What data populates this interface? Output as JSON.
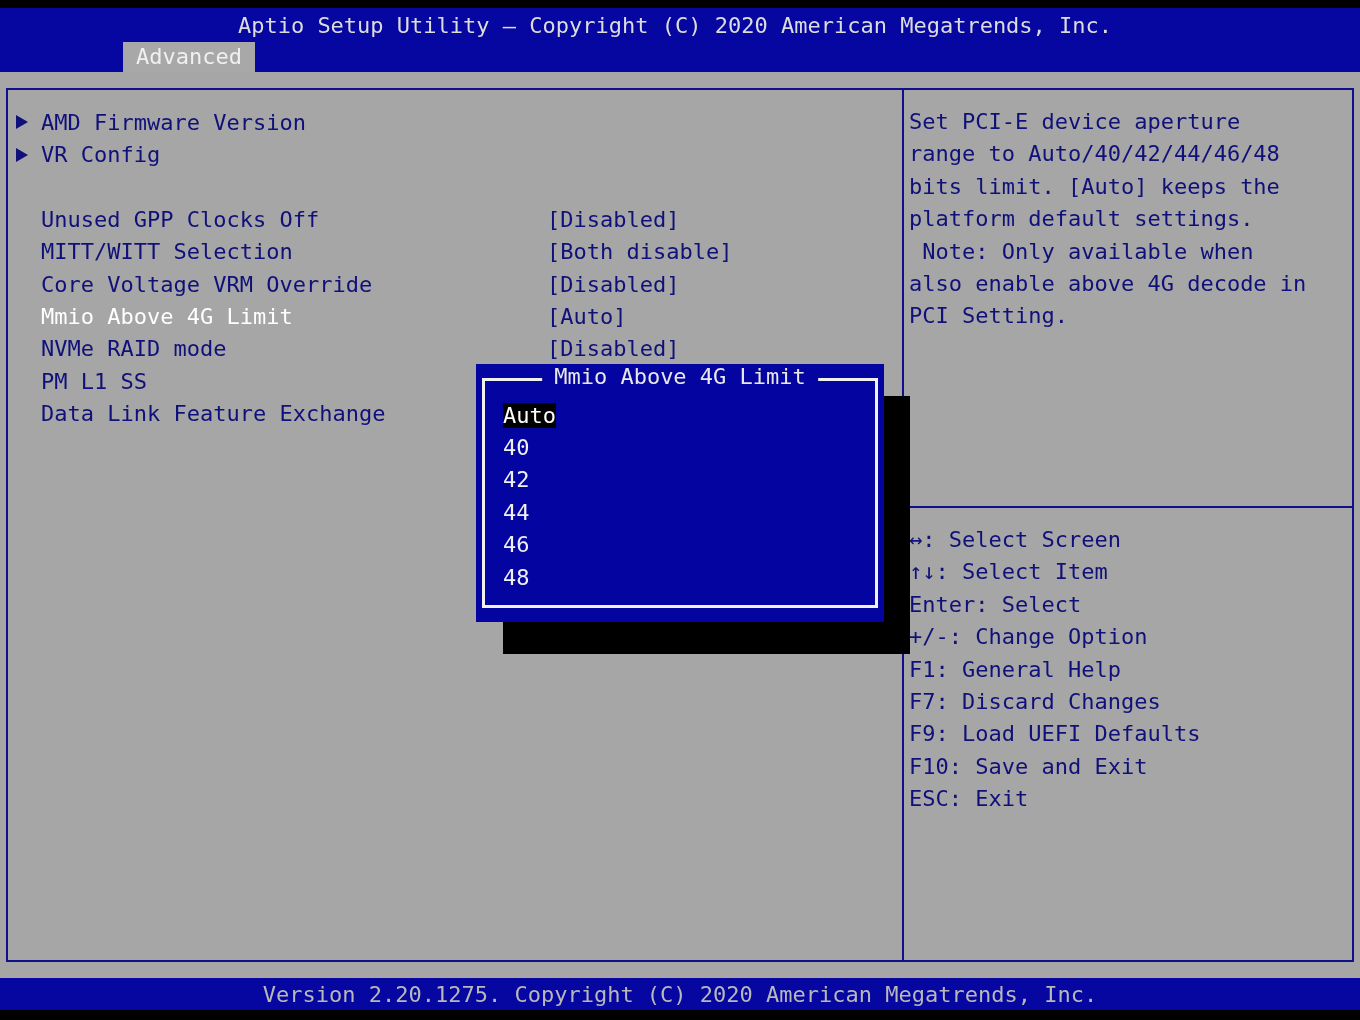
{
  "title_bar": {
    "title": "Aptio Setup Utility – Copyright (C) 2020 American Megatrends, Inc."
  },
  "tabs": [
    {
      "label": "Advanced",
      "selected": true
    }
  ],
  "menu_items": [
    {
      "kind": "submenu",
      "label": "AMD Firmware Version",
      "selected": false
    },
    {
      "kind": "submenu",
      "label": "VR Config",
      "selected": false
    },
    {
      "kind": "spacer"
    },
    {
      "kind": "setting",
      "label": "Unused GPP Clocks Off",
      "value": "[Disabled]",
      "selected": false
    },
    {
      "kind": "setting",
      "label": "MITT/WITT Selection",
      "value": "[Both disable]",
      "selected": false
    },
    {
      "kind": "setting",
      "label": "Core Voltage VRM Override",
      "value": "[Disabled]",
      "selected": false
    },
    {
      "kind": "setting",
      "label": "Mmio Above 4G Limit",
      "value": "[Auto]",
      "selected": true
    },
    {
      "kind": "setting",
      "label": "NVMe RAID mode",
      "value": "[Disabled]",
      "selected": false
    },
    {
      "kind": "setting",
      "label": "PM L1 SS",
      "selected": false
    },
    {
      "kind": "setting",
      "label": "Data Link Feature Exchange",
      "selected": false
    }
  ],
  "popup": {
    "title": "Mmio Above 4G Limit",
    "options": [
      {
        "label": "Auto",
        "selected": true
      },
      {
        "label": "40",
        "selected": false
      },
      {
        "label": "42",
        "selected": false
      },
      {
        "label": "44",
        "selected": false
      },
      {
        "label": "46",
        "selected": false
      },
      {
        "label": "48",
        "selected": false
      }
    ]
  },
  "help_lines": [
    "Set PCI-E device aperture",
    "range to Auto/40/42/44/46/48",
    "bits limit. [Auto] keeps the",
    "platform default settings.",
    " Note: Only available when",
    "also enable above 4G decode in",
    "PCI Setting."
  ],
  "key_legend": [
    "↔: Select Screen",
    "↑↓: Select Item",
    "Enter: Select",
    "+/-: Change Option",
    "F1: General Help",
    "F7: Discard Changes",
    "F9: Load UEFI Defaults",
    "F10: Save and Exit",
    "ESC: Exit"
  ],
  "status_bar": {
    "text": "Version 2.20.1275. Copyright (C) 2020 American Megatrends, Inc."
  }
}
